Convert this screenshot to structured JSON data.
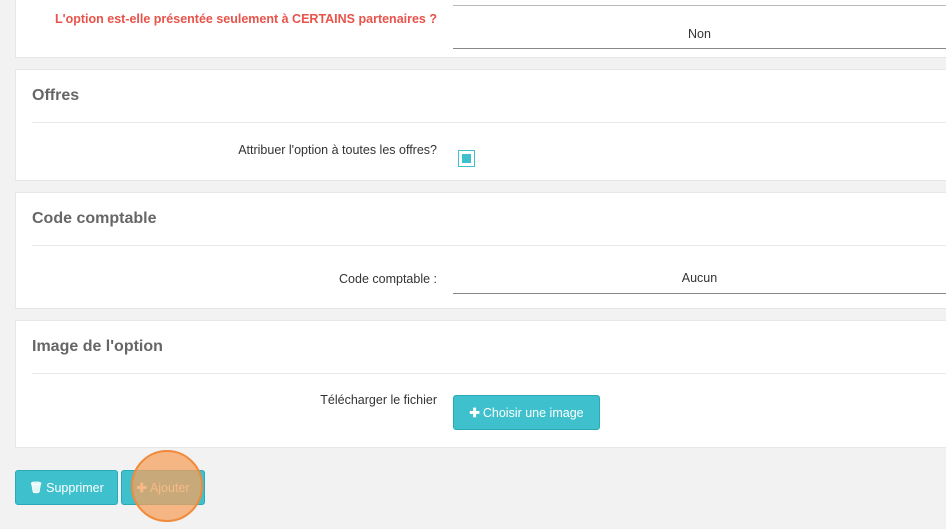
{
  "partners": {
    "question": "L'option est-elle présentée seulement à CERTAINS partenaires ?",
    "value": "Non"
  },
  "offres": {
    "title": "Offres",
    "label": "Attribuer l'option à toutes les offres?",
    "checked": true
  },
  "code": {
    "title": "Code comptable",
    "label": "Code comptable :",
    "value": "Aucun"
  },
  "image": {
    "title": "Image de l'option",
    "label": "Télécharger le fichier",
    "button_label": "Choisir une image",
    "button_icon": "plus-icon"
  },
  "actions": {
    "delete_label": "Supprimer",
    "delete_icon": "trash-icon",
    "add_label": "Ajouter",
    "add_icon": "plus-icon"
  },
  "colors": {
    "accent": "#3fc0cd",
    "warning_text": "#e8534a",
    "highlight": "#f5a25d"
  }
}
